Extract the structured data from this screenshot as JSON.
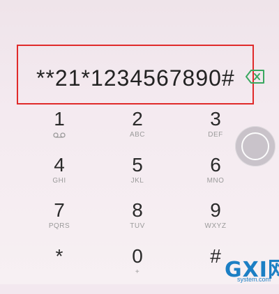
{
  "dialer": {
    "number": "**21*1234567890#",
    "keys": [
      {
        "digit": "1",
        "letters": ""
      },
      {
        "digit": "2",
        "letters": "ABC"
      },
      {
        "digit": "3",
        "letters": "DEF"
      },
      {
        "digit": "4",
        "letters": "GHI"
      },
      {
        "digit": "5",
        "letters": "JKL"
      },
      {
        "digit": "6",
        "letters": "MNO"
      },
      {
        "digit": "7",
        "letters": "PQRS"
      },
      {
        "digit": "8",
        "letters": "TUV"
      },
      {
        "digit": "9",
        "letters": "WXYZ"
      },
      {
        "digit": "*",
        "letters": ""
      },
      {
        "digit": "0",
        "letters": "+"
      },
      {
        "digit": "#",
        "letters": ""
      }
    ]
  },
  "icons": {
    "backspace": "backspace-icon",
    "voicemail": "voicemail-icon",
    "assistive_touch": "assistive-touch-icon"
  },
  "colors": {
    "highlight_border": "#e02a2a",
    "backspace_accent": "#3aa860",
    "watermark": "#1c7fc4"
  },
  "watermark": {
    "brand": "GXI网",
    "url": "system.com"
  }
}
